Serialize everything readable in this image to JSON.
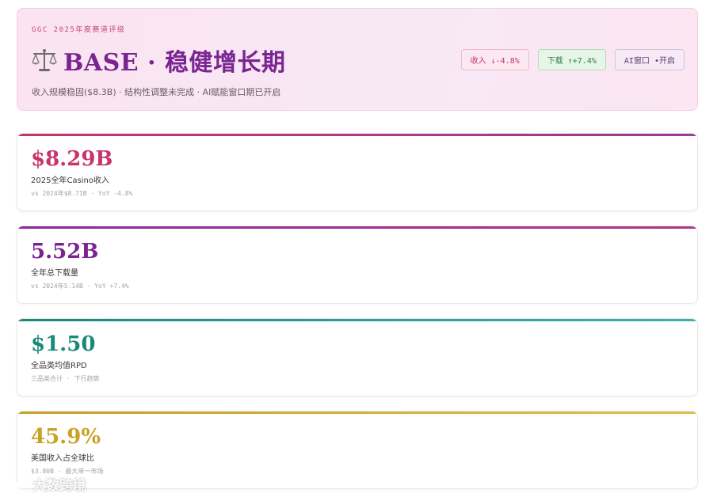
{
  "header": {
    "eyebrow": "GGC 2025年度赛道评级",
    "title_icon": "balance-scale-icon",
    "title": "BASE · 稳健增长期",
    "subtitle": "收入规模稳固($8.3B) · 结构性调整未完成 · AI赋能窗口期已开启",
    "badges": {
      "revenue": "收入 ↓-4.8%",
      "downloads": "下载 ↑+7.4%",
      "ai": "AI窗口 •开启"
    }
  },
  "colors": {
    "accent_pink": "#c8336c",
    "accent_purple": "#7a2492",
    "accent_teal": "#1a8a78",
    "accent_gold": "#c9a227"
  },
  "cards": [
    {
      "value": "$8.29B",
      "label": "2025全年Casino收入",
      "note": "vs 2024年$8.71B · YoY -4.8%"
    },
    {
      "value": "5.52B",
      "label": "全年总下载量",
      "note": "vs 2024年5.14B · YoY +7.4%"
    },
    {
      "value": "$1.50",
      "label": "全品类均值RPD",
      "note": "三品类合计 · 下行趋势"
    },
    {
      "value": "45.9%",
      "label": "美国收入占全球比",
      "note": "$3.80B · 最大单一市场"
    }
  ],
  "watermark": {
    "icon": "logo-icon",
    "text": "大数跨境"
  }
}
